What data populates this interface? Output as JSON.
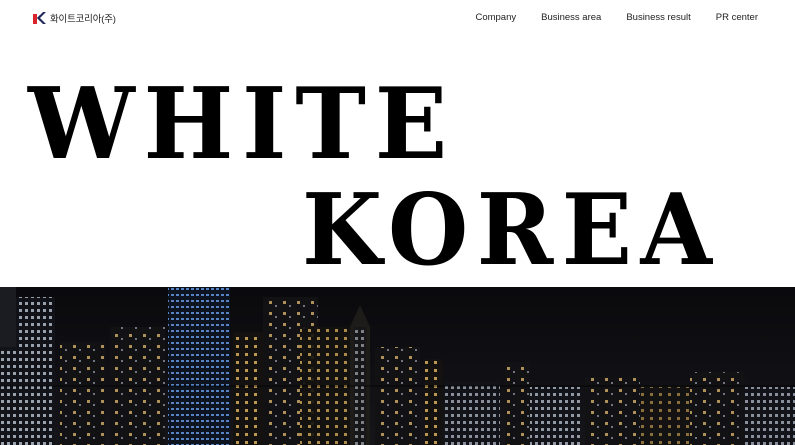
{
  "header": {
    "logo": {
      "icon": "white-korea-logo-icon",
      "text": "화이트코리아(주)"
    },
    "nav": [
      {
        "label": "Company"
      },
      {
        "label": "Business area"
      },
      {
        "label": "Business result"
      },
      {
        "label": "PR center"
      }
    ]
  },
  "hero": {
    "line1": "WHITE",
    "line2": "KOREA",
    "background": "night-city-skyline-image"
  },
  "colors": {
    "text": "#000000",
    "background": "#ffffff",
    "logo_red": "#d9252b",
    "logo_navy": "#1f2a5a",
    "night_sky": "#0b0b0e"
  }
}
